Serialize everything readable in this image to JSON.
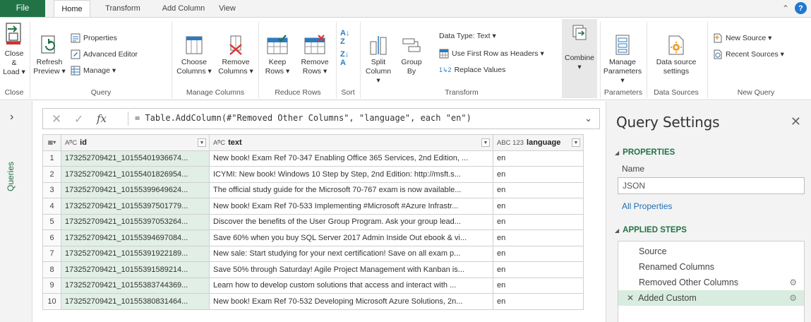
{
  "tabs": {
    "file": "File",
    "items": [
      "Home",
      "Transform",
      "Add Column",
      "View"
    ]
  },
  "ribbon": {
    "close_load": [
      "Close &",
      "Load ▾"
    ],
    "refresh_preview": [
      "Refresh",
      "Preview ▾"
    ],
    "properties": "Properties",
    "advanced_editor": "Advanced Editor",
    "manage": "Manage ▾",
    "choose_columns": [
      "Choose",
      "Columns ▾"
    ],
    "remove_columns": [
      "Remove",
      "Columns ▾"
    ],
    "keep_rows": [
      "Keep",
      "Rows ▾"
    ],
    "remove_rows": [
      "Remove",
      "Rows ▾"
    ],
    "split_column": [
      "Split",
      "Column ▾"
    ],
    "group_by": [
      "Group",
      "By"
    ],
    "data_type": "Data Type: Text ▾",
    "first_row_headers": "Use First Row as Headers ▾",
    "replace_values": "Replace Values",
    "combine": [
      "Combine",
      "▾"
    ],
    "manage_parameters": [
      "Manage",
      "Parameters ▾"
    ],
    "data_source_settings": [
      "Data source",
      "settings"
    ],
    "new_source": "New Source ▾",
    "recent_sources": "Recent Sources ▾",
    "groups": {
      "close": "Close",
      "query": "Query",
      "manage_columns": "Manage Columns",
      "reduce_rows": "Reduce Rows",
      "sort": "Sort",
      "transform": "Transform",
      "parameters": "Parameters",
      "data_sources": "Data Sources",
      "new_query": "New Query"
    }
  },
  "queries_pane": {
    "label": "Queries"
  },
  "formula_bar": {
    "formula": "= Table.AddColumn(#\"Removed Other Columns\", \"language\", each \"en\")"
  },
  "grid": {
    "columns": [
      {
        "type": "AᴮC",
        "name": "id"
      },
      {
        "type": "AᴮC",
        "name": "text"
      },
      {
        "type": "ABC 123",
        "name": "language"
      }
    ],
    "rows": [
      {
        "n": "1",
        "id": "173252709421_10155401936674...",
        "text": "New book! Exam Ref 70-347 Enabling Office 365 Services, 2nd Edition, ...",
        "lang": "en"
      },
      {
        "n": "2",
        "id": "173252709421_10155401826954...",
        "text": "ICYMI: New book! Windows 10 Step by Step, 2nd Edition: http://msft.s...",
        "lang": "en"
      },
      {
        "n": "3",
        "id": "173252709421_10155399649624...",
        "text": "The official study guide for the Microsoft 70-767 exam is now available...",
        "lang": "en"
      },
      {
        "n": "4",
        "id": "173252709421_10155397501779...",
        "text": "New book! Exam Ref 70-533 Implementing #Microsoft #Azure Infrastr...",
        "lang": "en"
      },
      {
        "n": "5",
        "id": "173252709421_10155397053264...",
        "text": "Discover the benefits of the User Group Program. Ask your group lead...",
        "lang": "en"
      },
      {
        "n": "6",
        "id": "173252709421_10155394697084...",
        "text": "Save 60% when you buy SQL Server 2017 Admin Inside Out ebook & vi...",
        "lang": "en"
      },
      {
        "n": "7",
        "id": "173252709421_10155391922189...",
        "text": "New sale: Start studying for your next certification! Save on all exam p...",
        "lang": "en"
      },
      {
        "n": "8",
        "id": "173252709421_10155391589214...",
        "text": "Save 50% through Saturday! Agile Project Management with Kanban is...",
        "lang": "en"
      },
      {
        "n": "9",
        "id": "173252709421_10155383744369...",
        "text": "Learn how to develop custom solutions that access and interact with ...",
        "lang": "en"
      },
      {
        "n": "10",
        "id": "173252709421_10155380831464...",
        "text": "New book! Exam Ref 70-532 Developing Microsoft Azure Solutions, 2n...",
        "lang": "en"
      }
    ]
  },
  "settings": {
    "title": "Query Settings",
    "properties_heading": "PROPERTIES",
    "name_label": "Name",
    "name_value": "JSON",
    "all_properties": "All Properties",
    "steps_heading": "APPLIED STEPS",
    "steps": [
      "Source",
      "Renamed Columns",
      "Removed Other Columns",
      "Added Custom"
    ]
  },
  "colors": {
    "accent_green": "#217346",
    "link_blue": "#1e6fb5",
    "selected_step": "#d8eddf",
    "id_column_bg": "#e1efe6"
  }
}
